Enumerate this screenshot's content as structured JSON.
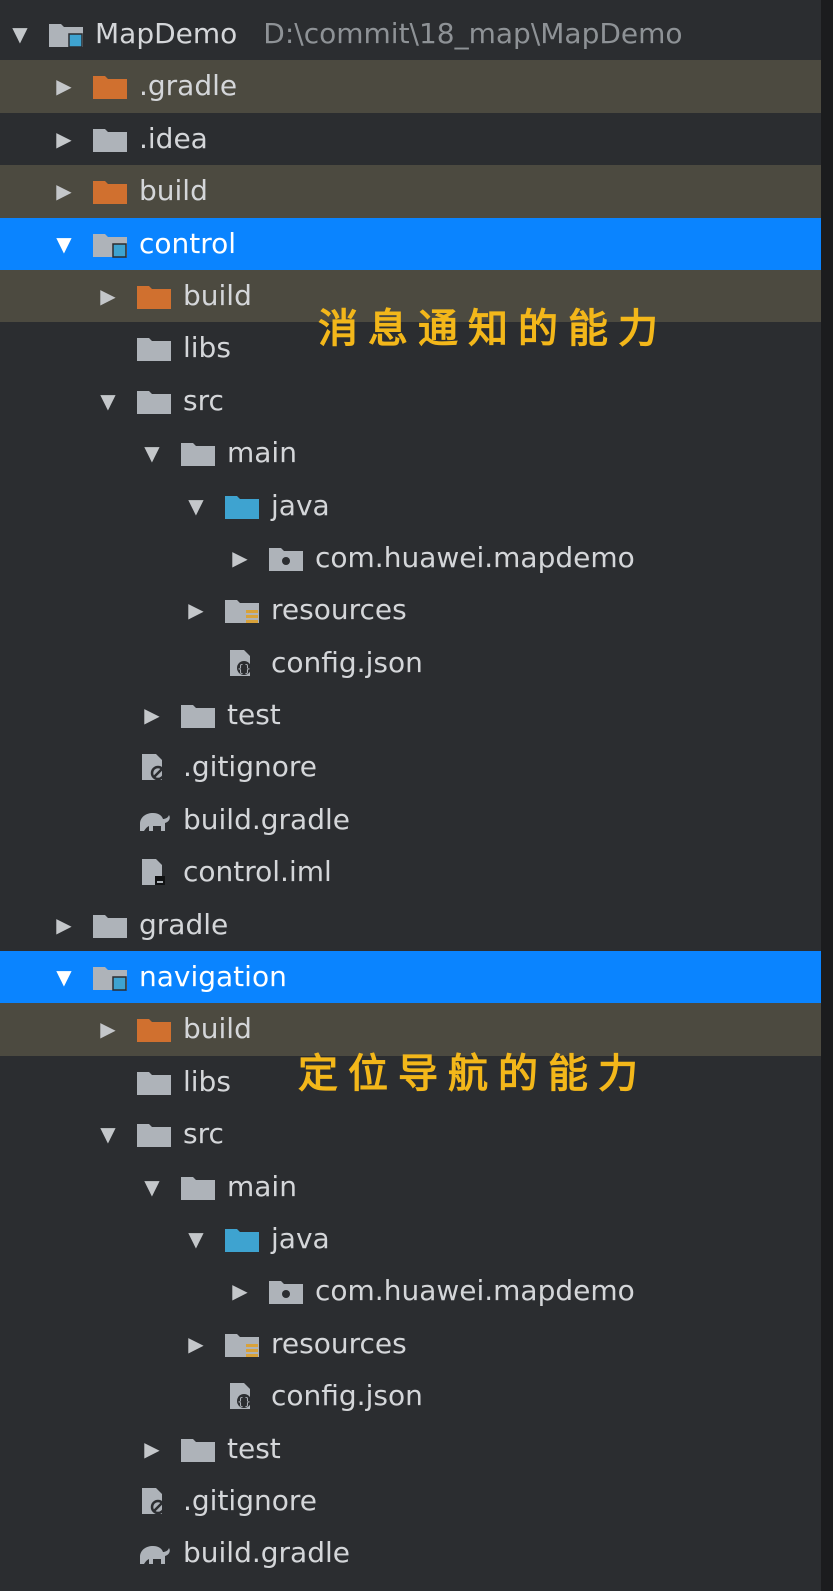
{
  "tree": {
    "rows": [
      {
        "label": "MapDemo",
        "path": "D:\\commit\\18_map\\MapDemo",
        "level": 0,
        "arrow": "down",
        "icon": "module-folder-icon",
        "state": ""
      },
      {
        "label": ".gradle",
        "level": 1,
        "arrow": "right",
        "icon": "folder-orange-icon",
        "state": "excluded"
      },
      {
        "label": ".idea",
        "level": 1,
        "arrow": "right",
        "icon": "folder-gray-icon",
        "state": ""
      },
      {
        "label": "build",
        "level": 1,
        "arrow": "right",
        "icon": "folder-orange-icon",
        "state": "excluded"
      },
      {
        "label": "control",
        "level": 1,
        "arrow": "down",
        "icon": "module-folder-icon",
        "state": "selected"
      },
      {
        "label": "build",
        "level": 2,
        "arrow": "right",
        "icon": "folder-orange-icon",
        "state": "excluded"
      },
      {
        "label": "libs",
        "level": 2,
        "arrow": "none",
        "icon": "folder-gray-icon",
        "state": ""
      },
      {
        "label": "src",
        "level": 2,
        "arrow": "down",
        "icon": "folder-gray-icon",
        "state": ""
      },
      {
        "label": "main",
        "level": 3,
        "arrow": "down",
        "icon": "folder-gray-icon",
        "state": ""
      },
      {
        "label": "java",
        "level": 4,
        "arrow": "down",
        "icon": "folder-blue-icon",
        "state": ""
      },
      {
        "label": "com.huawei.mapdemo",
        "level": 5,
        "arrow": "right",
        "icon": "package-folder-icon",
        "state": ""
      },
      {
        "label": "resources",
        "level": 4,
        "arrow": "right",
        "icon": "resources-folder-icon",
        "state": ""
      },
      {
        "label": "config.json",
        "level": 4,
        "arrow": "none",
        "icon": "json-file-icon",
        "state": ""
      },
      {
        "label": "test",
        "level": 3,
        "arrow": "right",
        "icon": "folder-gray-icon",
        "state": ""
      },
      {
        "label": ".gitignore",
        "level": 2,
        "arrow": "none",
        "icon": "ignore-file-icon",
        "state": ""
      },
      {
        "label": "build.gradle",
        "level": 2,
        "arrow": "none",
        "icon": "gradle-elephant-icon",
        "state": ""
      },
      {
        "label": "control.iml",
        "level": 2,
        "arrow": "none",
        "icon": "iml-file-icon",
        "state": ""
      },
      {
        "label": "gradle",
        "level": 1,
        "arrow": "right",
        "icon": "folder-gray-icon",
        "state": ""
      },
      {
        "label": "navigation",
        "level": 1,
        "arrow": "down",
        "icon": "module-folder-icon",
        "state": "selected"
      },
      {
        "label": "build",
        "level": 2,
        "arrow": "right",
        "icon": "folder-orange-icon",
        "state": "excluded"
      },
      {
        "label": "libs",
        "level": 2,
        "arrow": "none",
        "icon": "folder-gray-icon",
        "state": ""
      },
      {
        "label": "src",
        "level": 2,
        "arrow": "down",
        "icon": "folder-gray-icon",
        "state": ""
      },
      {
        "label": "main",
        "level": 3,
        "arrow": "down",
        "icon": "folder-gray-icon",
        "state": ""
      },
      {
        "label": "java",
        "level": 4,
        "arrow": "down",
        "icon": "folder-blue-icon",
        "state": ""
      },
      {
        "label": "com.huawei.mapdemo",
        "level": 5,
        "arrow": "right",
        "icon": "package-folder-icon",
        "state": ""
      },
      {
        "label": "resources",
        "level": 4,
        "arrow": "right",
        "icon": "resources-folder-icon",
        "state": ""
      },
      {
        "label": "config.json",
        "level": 4,
        "arrow": "none",
        "icon": "json-file-icon",
        "state": ""
      },
      {
        "label": "test",
        "level": 3,
        "arrow": "right",
        "icon": "folder-gray-icon",
        "state": ""
      },
      {
        "label": ".gitignore",
        "level": 2,
        "arrow": "none",
        "icon": "ignore-file-icon",
        "state": ""
      },
      {
        "label": "build.gradle",
        "level": 2,
        "arrow": "none",
        "icon": "gradle-elephant-icon",
        "state": ""
      }
    ]
  },
  "annotations": {
    "control_note": "消息通知的能力",
    "navigation_note": "定位导航的能力"
  },
  "colors": {
    "background": "#2b2d30",
    "selected_row": "#0a84ff",
    "excluded_row": "#4c4a40",
    "annotation_text": "#f3b71a",
    "folder_gray": "#aeb3b9",
    "folder_orange": "#d0702f",
    "folder_blue": "#3ea3d0"
  }
}
